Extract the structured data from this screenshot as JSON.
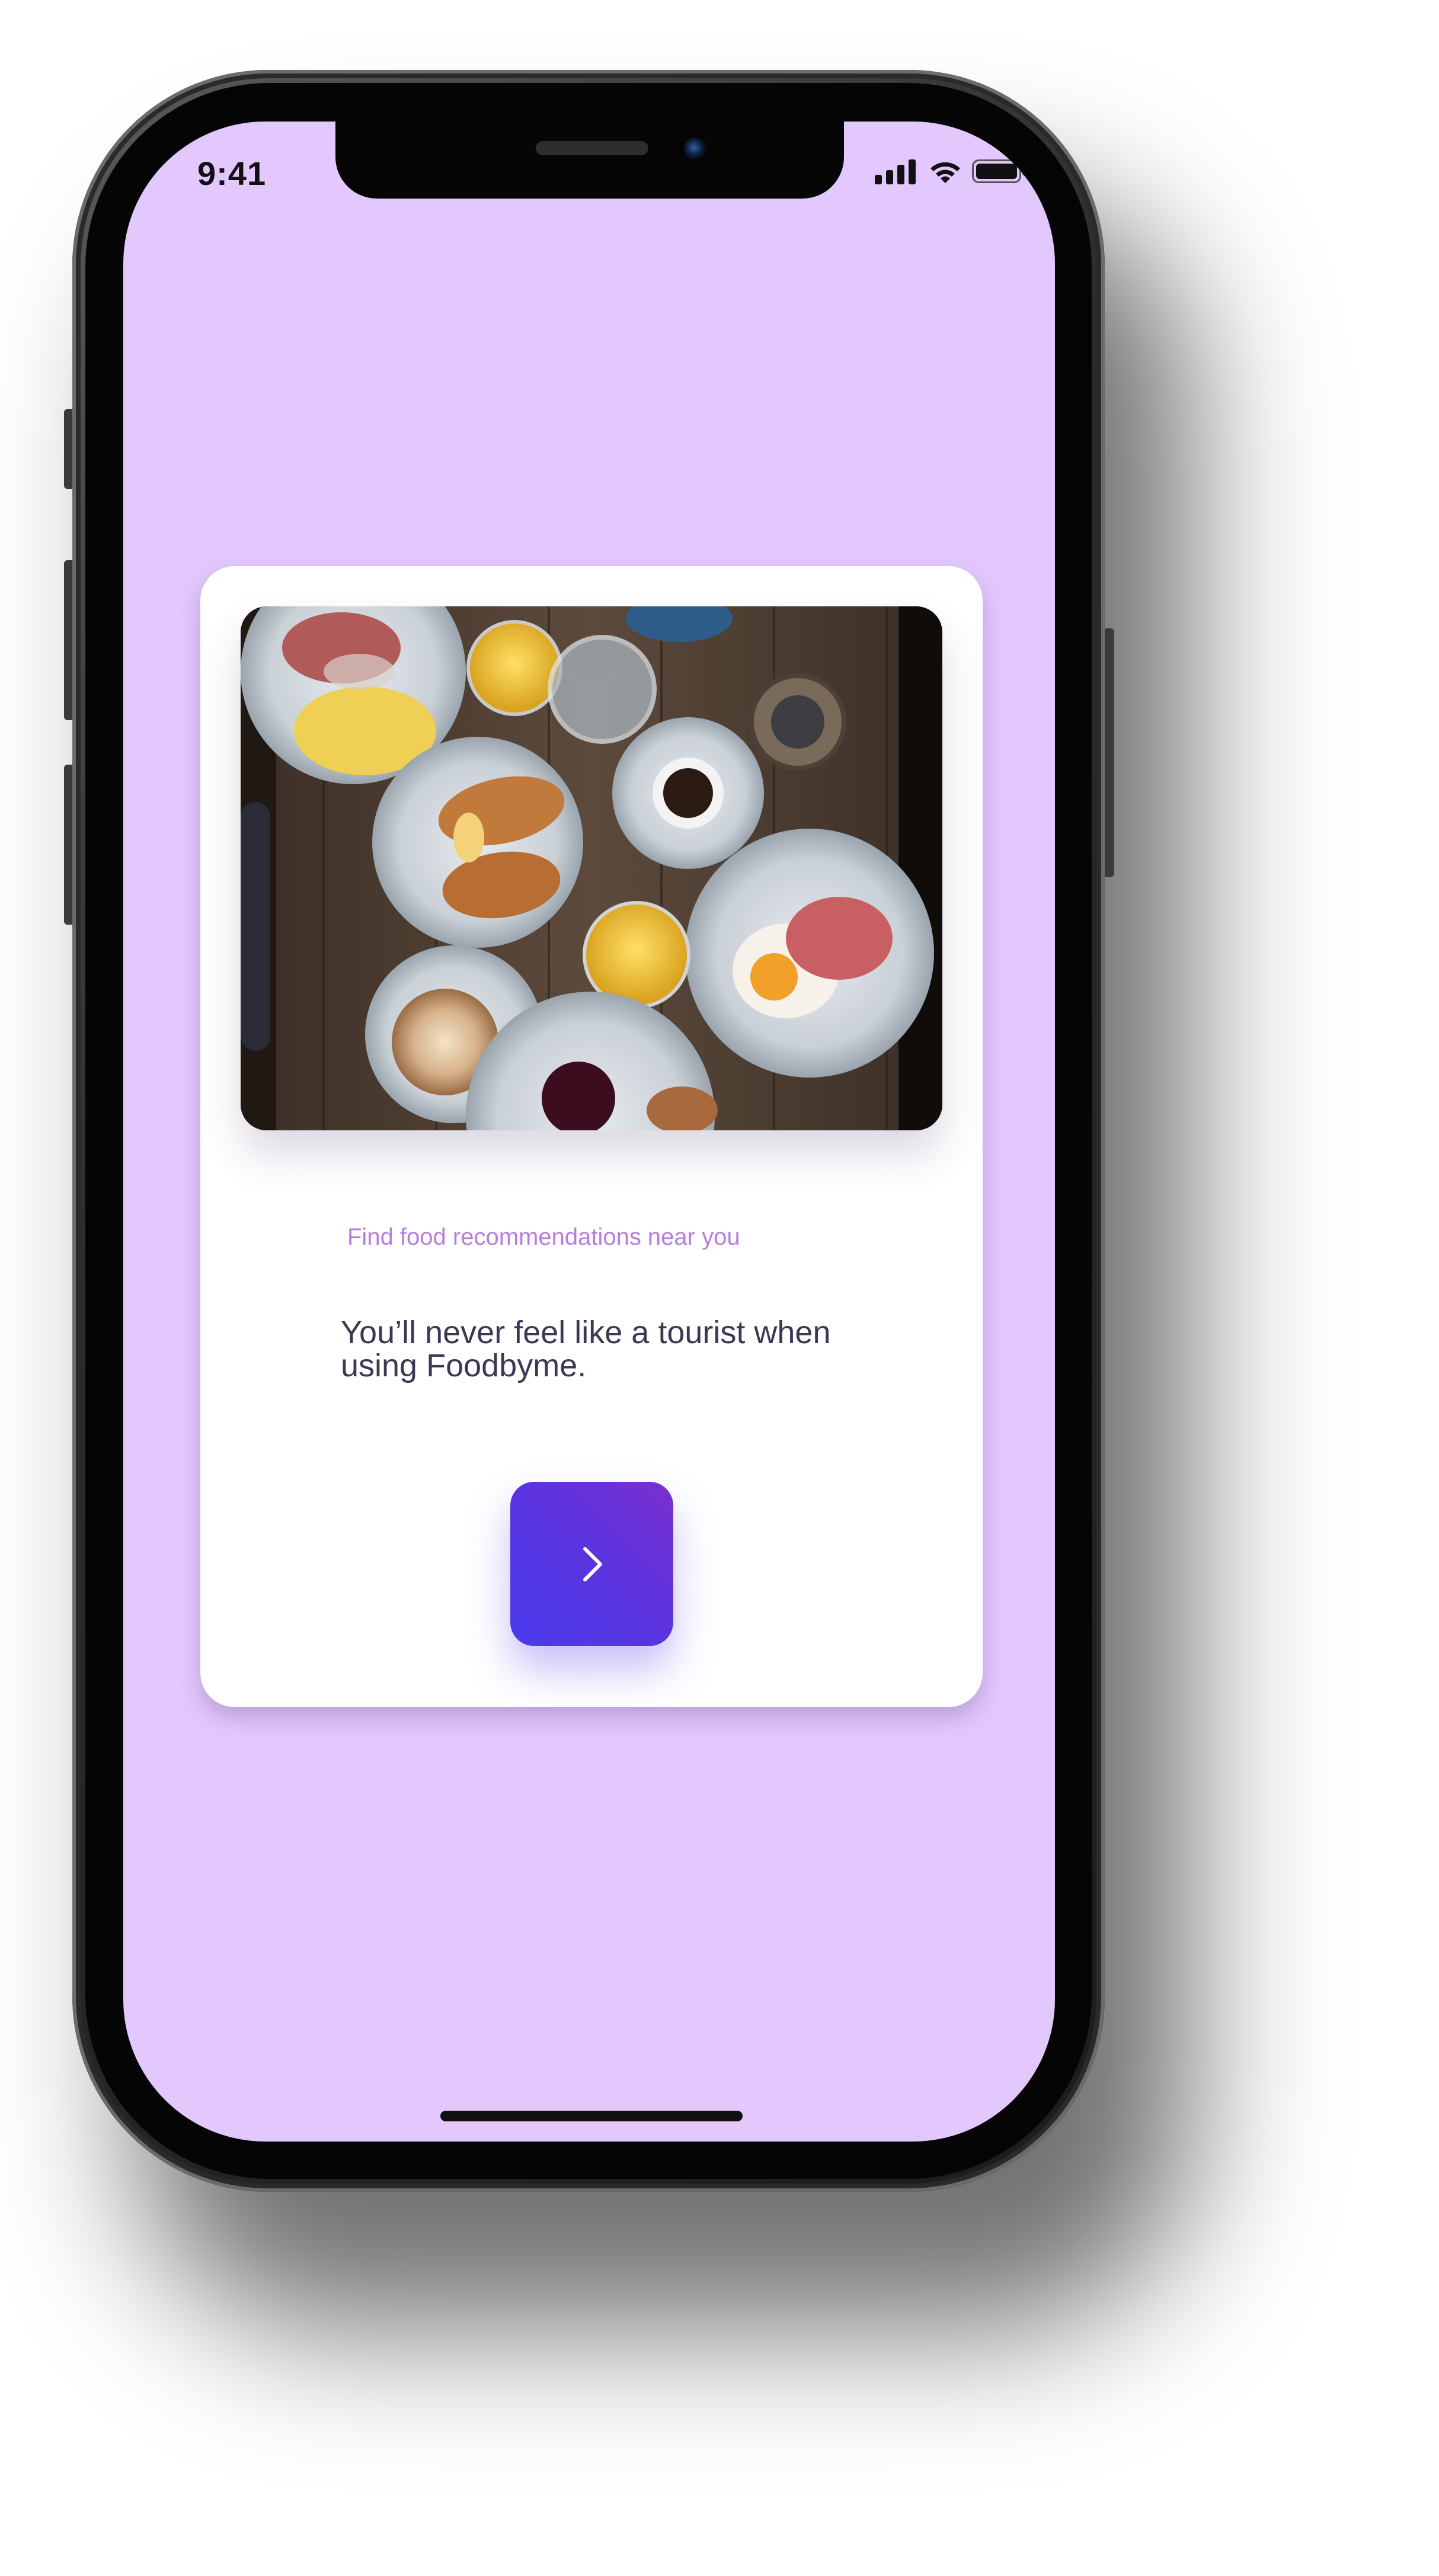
{
  "status_bar": {
    "time": "9:41"
  },
  "card": {
    "image_description_icon": "breakfast-table-photo",
    "subtitle": "Find food recommendations near you",
    "headline": "You’ll never feel like a tourist when using Foodbyme.",
    "next_icon": "chevron-right-icon"
  },
  "colors": {
    "screen_background": "#e2c8fd",
    "card_background": "#ffffff",
    "subtitle": "#b77ddd",
    "headline": "#3a3852",
    "button_gradient_start": "#7a2fd0",
    "button_gradient_end": "#4a3bec"
  }
}
